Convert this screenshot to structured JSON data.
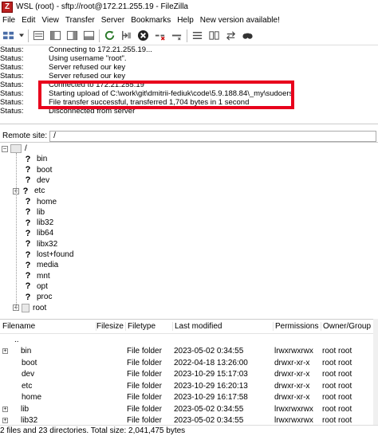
{
  "window": {
    "title": "WSL (root) - sftp://root@172.21.255.19 - FileZilla",
    "icon_letter": "Z"
  },
  "menu": [
    "File",
    "Edit",
    "View",
    "Transfer",
    "Server",
    "Bookmarks",
    "Help",
    "New version available!"
  ],
  "toolbar_icons": [
    "site-manager-icon",
    "chevron-down-icon",
    "toggle-log-icon",
    "toggle-local-tree-icon",
    "toggle-remote-tree-icon",
    "toggle-queue-icon",
    "refresh-icon",
    "process-queue-icon",
    "cancel-icon",
    "disconnect-icon",
    "reconnect-icon",
    "filter-icon",
    "compare-icon",
    "sync-browse-icon",
    "search-icon"
  ],
  "message_log": [
    {
      "type": "Status:",
      "text": "Connecting to 172.21.255.19..."
    },
    {
      "type": "Status:",
      "text": "Using username \"root\"."
    },
    {
      "type": "Status:",
      "text": "Server refused our key"
    },
    {
      "type": "Status:",
      "text": "Server refused our key"
    },
    {
      "type": "Status:",
      "text": "Connected to 172.21.255.19"
    },
    {
      "type": "Status:",
      "text": "Starting upload of C:\\work\\git\\dmitrii-fediuk\\code\\5.9.188.84\\_my\\sudoers"
    },
    {
      "type": "Status:",
      "text": "File transfer successful, transferred 1,704 bytes in 1 second"
    },
    {
      "type": "Status:",
      "text": "Disconnected from server"
    }
  ],
  "remote_site": {
    "label": "Remote site:",
    "path": "/"
  },
  "tree": {
    "root": "/",
    "items": [
      {
        "name": "bin",
        "expandable": false
      },
      {
        "name": "boot",
        "expandable": false
      },
      {
        "name": "dev",
        "expandable": false
      },
      {
        "name": "etc",
        "expandable": true
      },
      {
        "name": "home",
        "expandable": false
      },
      {
        "name": "lib",
        "expandable": false
      },
      {
        "name": "lib32",
        "expandable": false
      },
      {
        "name": "lib64",
        "expandable": false
      },
      {
        "name": "libx32",
        "expandable": false
      },
      {
        "name": "lost+found",
        "expandable": false
      },
      {
        "name": "media",
        "expandable": false
      },
      {
        "name": "mnt",
        "expandable": false
      },
      {
        "name": "opt",
        "expandable": false
      },
      {
        "name": "proc",
        "expandable": false
      },
      {
        "name": "root",
        "expandable": true
      }
    ]
  },
  "file_list": {
    "headers": {
      "name": "Filename",
      "size": "Filesize",
      "type": "Filetype",
      "modified": "Last modified",
      "perms": "Permissions",
      "owner": "Owner/Group"
    },
    "rows": [
      {
        "name": "..",
        "type": "",
        "modified": "",
        "perms": "",
        "owner": "",
        "marker": false
      },
      {
        "name": "bin",
        "type": "File folder",
        "modified": "2023-05-02 0:34:55",
        "perms": "lrwxrwxrwx",
        "owner": "root root",
        "marker": true
      },
      {
        "name": "boot",
        "type": "File folder",
        "modified": "2022-04-18 13:26:00",
        "perms": "drwxr-xr-x",
        "owner": "root root",
        "marker": false
      },
      {
        "name": "dev",
        "type": "File folder",
        "modified": "2023-10-29 15:17:03",
        "perms": "drwxr-xr-x",
        "owner": "root root",
        "marker": false
      },
      {
        "name": "etc",
        "type": "File folder",
        "modified": "2023-10-29 16:20:13",
        "perms": "drwxr-xr-x",
        "owner": "root root",
        "marker": false
      },
      {
        "name": "home",
        "type": "File folder",
        "modified": "2023-10-29 16:17:58",
        "perms": "drwxr-xr-x",
        "owner": "root root",
        "marker": false
      },
      {
        "name": "lib",
        "type": "File folder",
        "modified": "2023-05-02 0:34:55",
        "perms": "lrwxrwxrwx",
        "owner": "root root",
        "marker": true
      },
      {
        "name": "lib32",
        "type": "File folder",
        "modified": "2023-05-02 0:34:55",
        "perms": "lrwxrwxrwx",
        "owner": "root root",
        "marker": true
      }
    ]
  },
  "status_bar": "2 files and 23 directories. Total size: 2,041,475 bytes",
  "colors": {
    "highlight": "#e8001c"
  }
}
